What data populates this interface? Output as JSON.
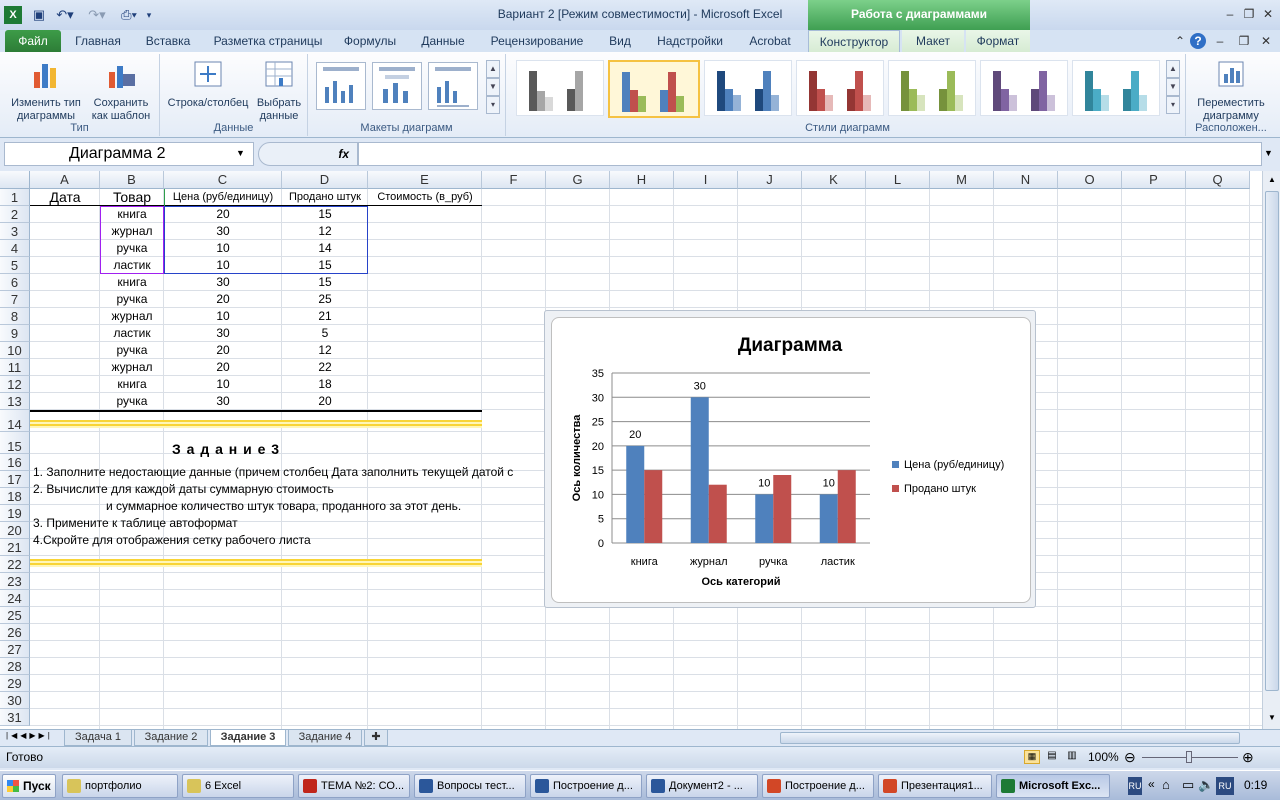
{
  "window": {
    "title": "Вариант 2  [Режим совместимости]  -  Microsoft Excel",
    "context_title": "Работа с диаграммами"
  },
  "tabs": [
    "Файл",
    "Главная",
    "Вставка",
    "Разметка страницы",
    "Формулы",
    "Данные",
    "Рецензирование",
    "Вид",
    "Надстройки",
    "Acrobat",
    "Конструктор",
    "Макет",
    "Формат"
  ],
  "ribbon": {
    "group_type": {
      "label": "Тип",
      "btn_change": "Изменить тип диаграммы",
      "btn_save": "Сохранить как шаблон"
    },
    "group_data": {
      "label": "Данные",
      "btn_switch": "Строка/столбец",
      "btn_select": "Выбрать данные"
    },
    "group_layouts": {
      "label": "Макеты диаграмм"
    },
    "group_styles": {
      "label": "Стили диаграмм"
    },
    "group_location": {
      "label": "Расположен...",
      "btn_move": "Переместить диаграмму"
    }
  },
  "formula_bar": {
    "name_box": "Диаграмма 2",
    "fx": "fx",
    "value": ""
  },
  "colors": {
    "series1": "#4f81bd",
    "series2": "#c0504d",
    "accent": "#3f9f52"
  },
  "columns": [
    "A",
    "B",
    "C",
    "D",
    "E",
    "F",
    "G",
    "H",
    "I",
    "J",
    "K",
    "L",
    "M",
    "N",
    "O",
    "P",
    "Q"
  ],
  "rows": [
    "1",
    "2",
    "3",
    "4",
    "5",
    "6",
    "7",
    "8",
    "9",
    "10",
    "11",
    "12",
    "13",
    "14",
    "15",
    "16",
    "17",
    "18",
    "19",
    "20",
    "21",
    "22",
    "23",
    "24",
    "25",
    "26",
    "27",
    "28",
    "29",
    "30",
    "31"
  ],
  "table": {
    "headers": [
      "Дата",
      "Товар",
      "Цена (руб/единицу)",
      "Продано штук",
      "Стоимость (в_руб)"
    ],
    "rows": [
      [
        "",
        "книга",
        "20",
        "15"
      ],
      [
        "",
        "журнал",
        "30",
        "12"
      ],
      [
        "",
        "ручка",
        "10",
        "14"
      ],
      [
        "",
        "ластик",
        "10",
        "15"
      ],
      [
        "",
        "книга",
        "30",
        "15"
      ],
      [
        "",
        "ручка",
        "20",
        "25"
      ],
      [
        "",
        "журнал",
        "10",
        "21"
      ],
      [
        "",
        "ластик",
        "30",
        "5"
      ],
      [
        "",
        "ручка",
        "20",
        "12"
      ],
      [
        "",
        "журнал",
        "20",
        "22"
      ],
      [
        "",
        "книга",
        "10",
        "18"
      ],
      [
        "",
        "ручка",
        "30",
        "20"
      ]
    ]
  },
  "task": {
    "title": "З а д а н и е 3",
    "lines": [
      "1. Заполните недостающие данные (причем столбец Дата заполнить текущей датой с",
      "2.  Вычислите для каждой даты суммарную стоимость",
      "и суммарное количество штук товара, проданного  за этот день.",
      "3. Примените к таблице автоформат",
      "4.Скройте для отображения сетку рабочего листа"
    ]
  },
  "chart_data": {
    "type": "bar",
    "title": "Диаграмма",
    "xlabel": "Ось категорий",
    "ylabel": "Ось количества",
    "categories": [
      "книга",
      "журнал",
      "ручка",
      "ластик"
    ],
    "series": [
      {
        "name": "Цена (руб/единицу)",
        "values": [
          20,
          30,
          10,
          10
        ],
        "color": "#4f81bd",
        "data_labels": true
      },
      {
        "name": "Продано штук",
        "values": [
          15,
          12,
          14,
          15
        ],
        "color": "#c0504d",
        "data_labels": false
      }
    ],
    "ylim": [
      0,
      35
    ],
    "yticks": [
      "0",
      "5",
      "10",
      "15",
      "20",
      "25",
      "30",
      "35"
    ],
    "grid": true,
    "legend": "right"
  },
  "sheets": [
    "Задача 1",
    "Задание 2",
    "Задание 3",
    "Задание 4"
  ],
  "status": {
    "ready": "Готово",
    "zoom": "100%"
  },
  "taskbar": {
    "start": "Пуск",
    "items": [
      "портфолио",
      "6 Excel",
      "ТЕМА №2: СО...",
      "Вопросы тест...",
      "Построение д...",
      "Документ2 - ...",
      "Построение д...",
      "Презентация1...",
      "Microsoft Exc..."
    ],
    "lang": "RU",
    "clock": "0:19"
  }
}
